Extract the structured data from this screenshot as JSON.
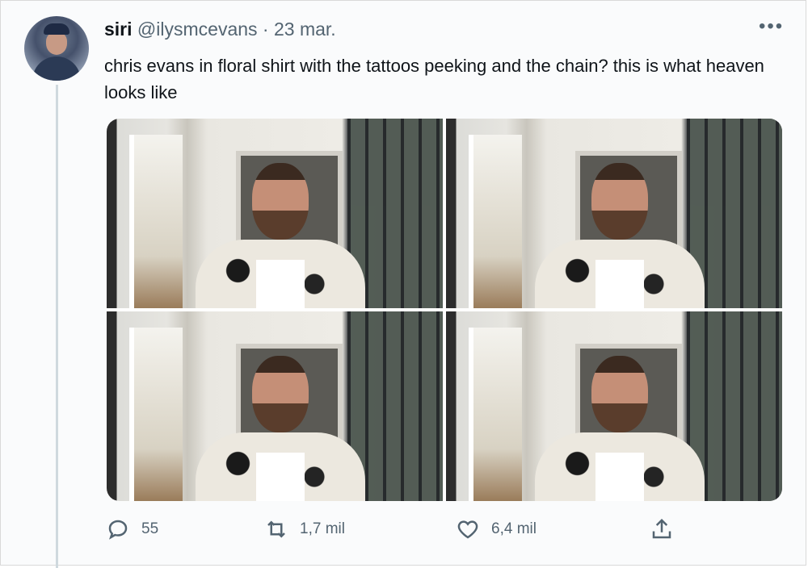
{
  "tweet": {
    "author_name": "siri",
    "handle": "@ilysmcevans",
    "separator": " · ",
    "date": "23 mar.",
    "more_icon": "more-horizontal-icon",
    "text": "chris evans in floral shirt with the tattoos peeking and the chain? this is what heaven looks like"
  },
  "media": {
    "photo_count": 4
  },
  "actions": {
    "reply": {
      "icon": "reply-icon",
      "count": "55"
    },
    "retweet": {
      "icon": "retweet-icon",
      "count": "1,7 mil"
    },
    "like": {
      "icon": "heart-icon",
      "count": "6,4 mil"
    },
    "share": {
      "icon": "share-icon",
      "count": ""
    }
  },
  "colors": {
    "text_primary": "#0f1419",
    "text_secondary": "#536471",
    "thread_line": "#cfd9de",
    "background": "#fafbfc"
  }
}
